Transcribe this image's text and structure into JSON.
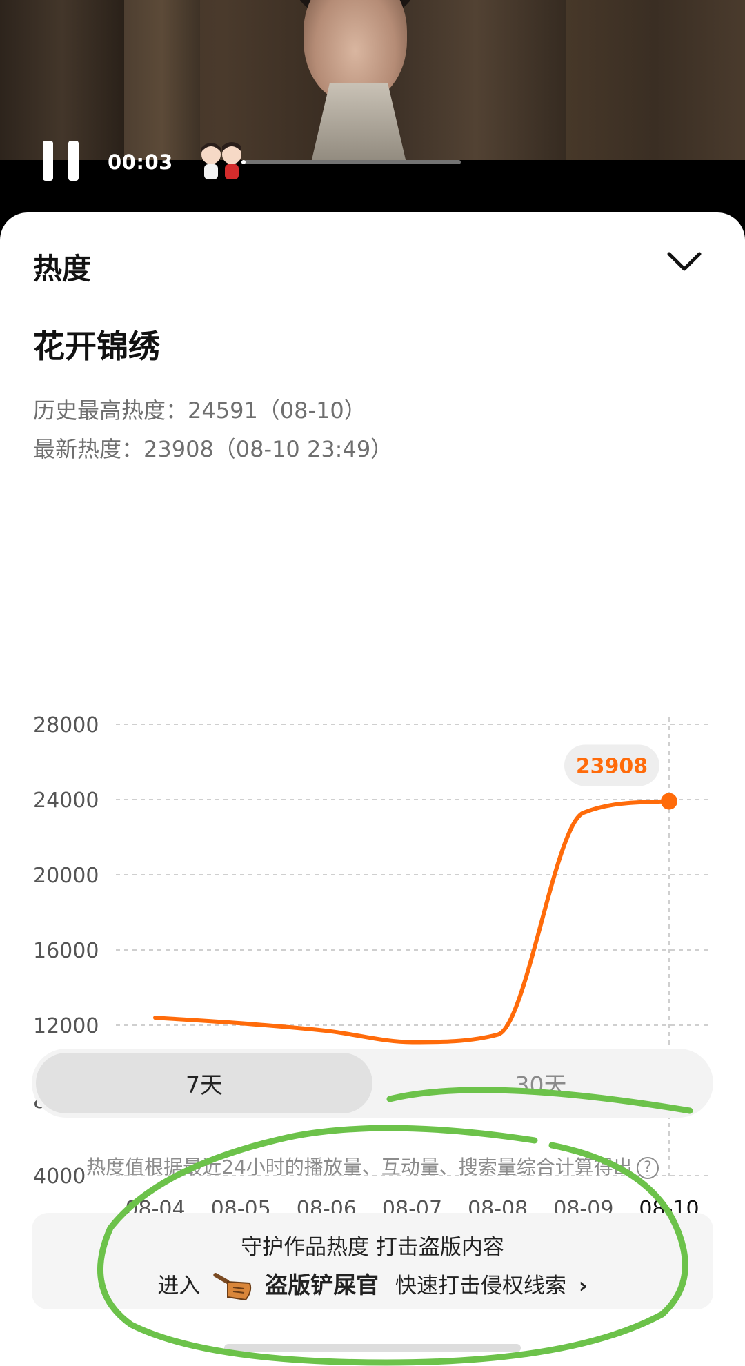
{
  "video": {
    "elapsed": "00:03",
    "progress": 0.02,
    "caption": ""
  },
  "sheet": {
    "title": "热度",
    "show_title": "花开锦绣",
    "peak_line": "历史最高热度：24591（08-10）",
    "latest_line": "最新热度：23908（08-10 23:49）"
  },
  "chart_data": {
    "type": "line",
    "x": [
      "08-04",
      "08-05",
      "08-06",
      "08-07",
      "08-08",
      "08-09",
      "08-10"
    ],
    "series": [
      {
        "values": [
          12400,
          12100,
          11700,
          11100,
          11500,
          23300,
          23908
        ],
        "color": "#ff6b0a"
      }
    ],
    "yticks": [
      28000,
      24000,
      20000,
      16000,
      12000,
      8000,
      4000
    ],
    "ylim": [
      4000,
      28000
    ],
    "callout": "23908",
    "grid": "dashed-horizontal",
    "highlight_x": "08-10"
  },
  "range": {
    "options": [
      "7天",
      "30天"
    ],
    "selected": "7天"
  },
  "footnote": "热度值根据最近24小时的播放量、互动量、搜索量综合计算得出",
  "promo": {
    "line1": "守护作品热度 打击盗版内容",
    "prefix": "进入",
    "brand": "盗版铲屎官",
    "suffix": "快速打击侵权线索",
    "arrow": "›"
  },
  "colors": {
    "accent": "#ff6b0a",
    "annotation": "#6cc24a"
  }
}
